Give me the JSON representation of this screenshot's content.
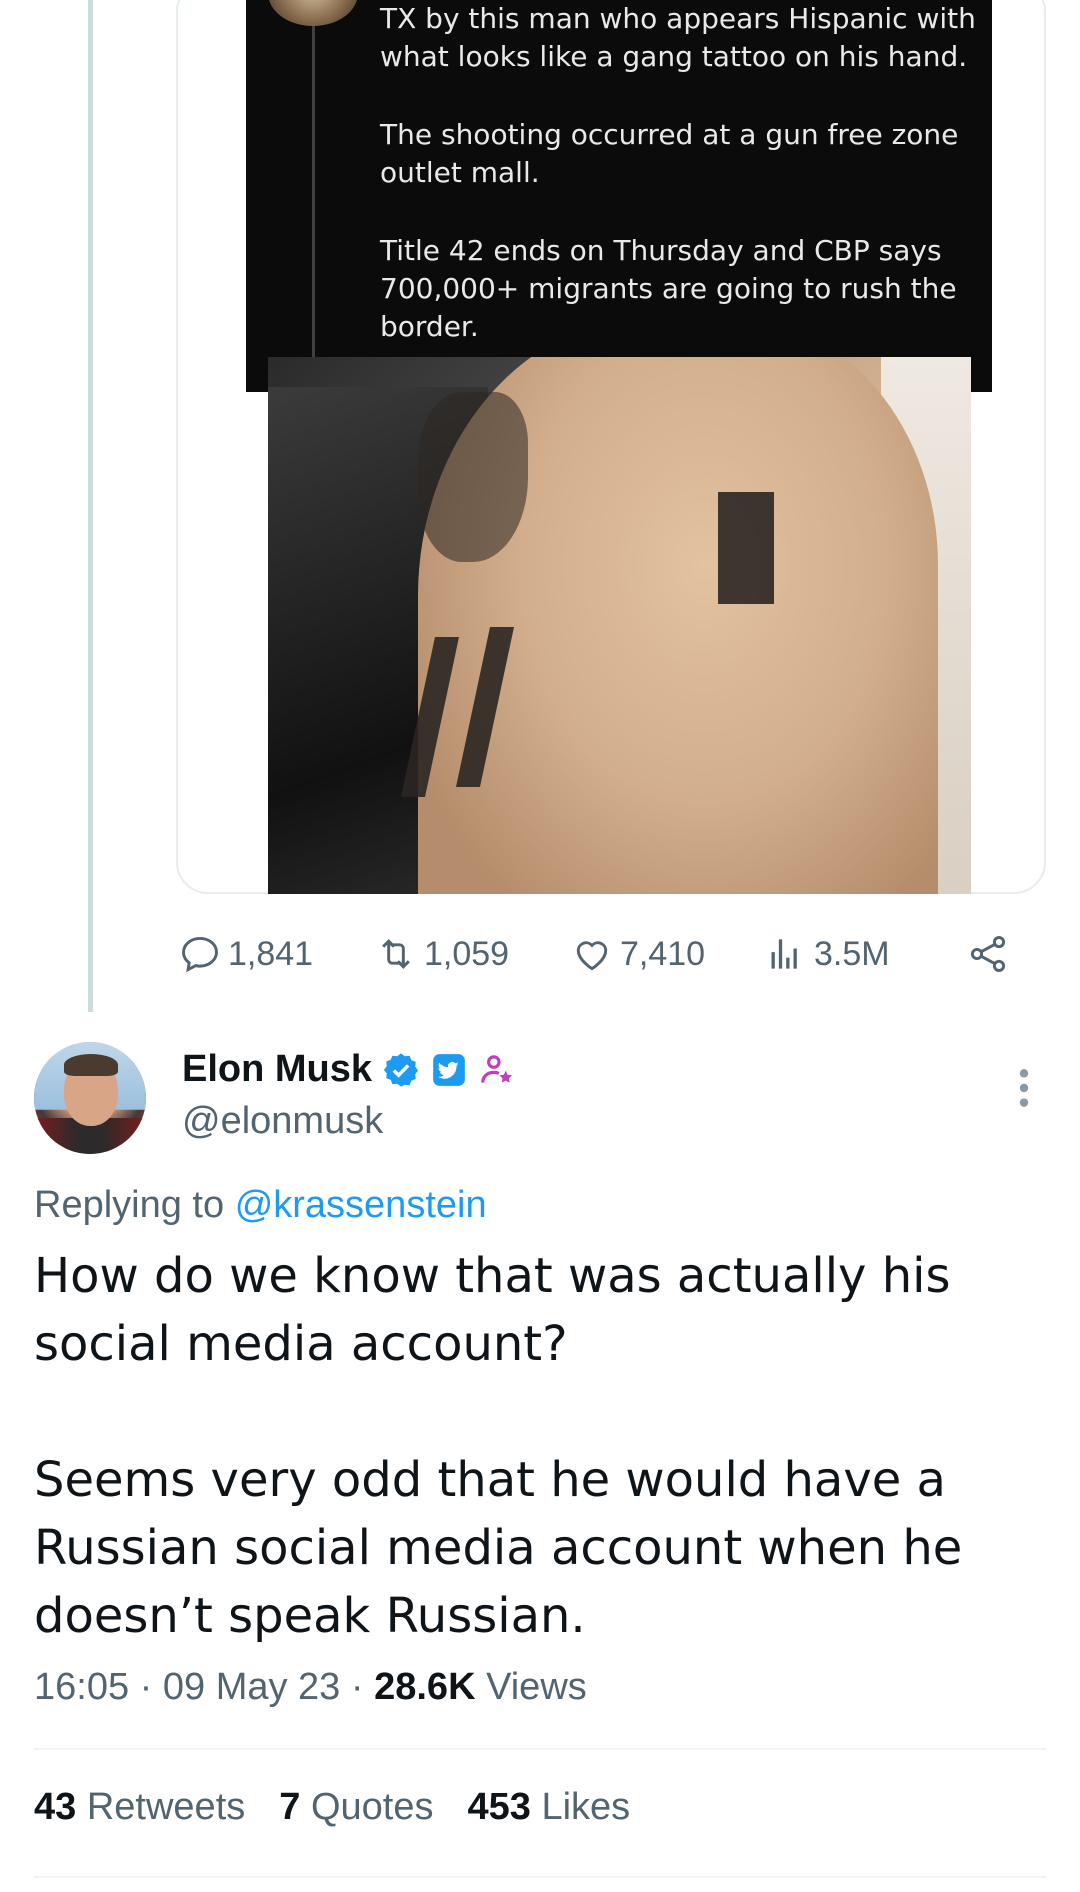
{
  "quoted_tweet": {
    "paragraphs": [
      "TX by this man who appears Hispanic with what looks like a gang tattoo on his hand.",
      "The shooting occurred at a gun free zone outlet mall.",
      "Title 42 ends on Thursday and CBP says 700,000+ migrants are going to rush the border."
    ]
  },
  "engagement": {
    "replies": "1,841",
    "retweets": "1,059",
    "likes": "7,410",
    "views": "3.5M"
  },
  "reply": {
    "name": "Elon Musk",
    "handle": "@elonmusk",
    "replying_prefix": "Replying to",
    "replying_to": "@krassenstein",
    "paragraphs": [
      "How do we know that was actually his social media account?",
      "Seems very odd that he would have a Russian social media account when he doesn’t speak Russian."
    ],
    "time": "16:05",
    "date": "09 May 23",
    "views_count": "28.6K",
    "views_label": "Views",
    "retweets_count": "43",
    "retweets_label": "Retweets",
    "quotes_count": "7",
    "quotes_label": "Quotes",
    "likes_count": "453",
    "likes_label": "Likes"
  },
  "colors": {
    "accent": "#1d9bf0",
    "secondary_text": "#536471",
    "verified_badge": "#1d9bf0",
    "affiliate_badge": "#c13ec1"
  }
}
